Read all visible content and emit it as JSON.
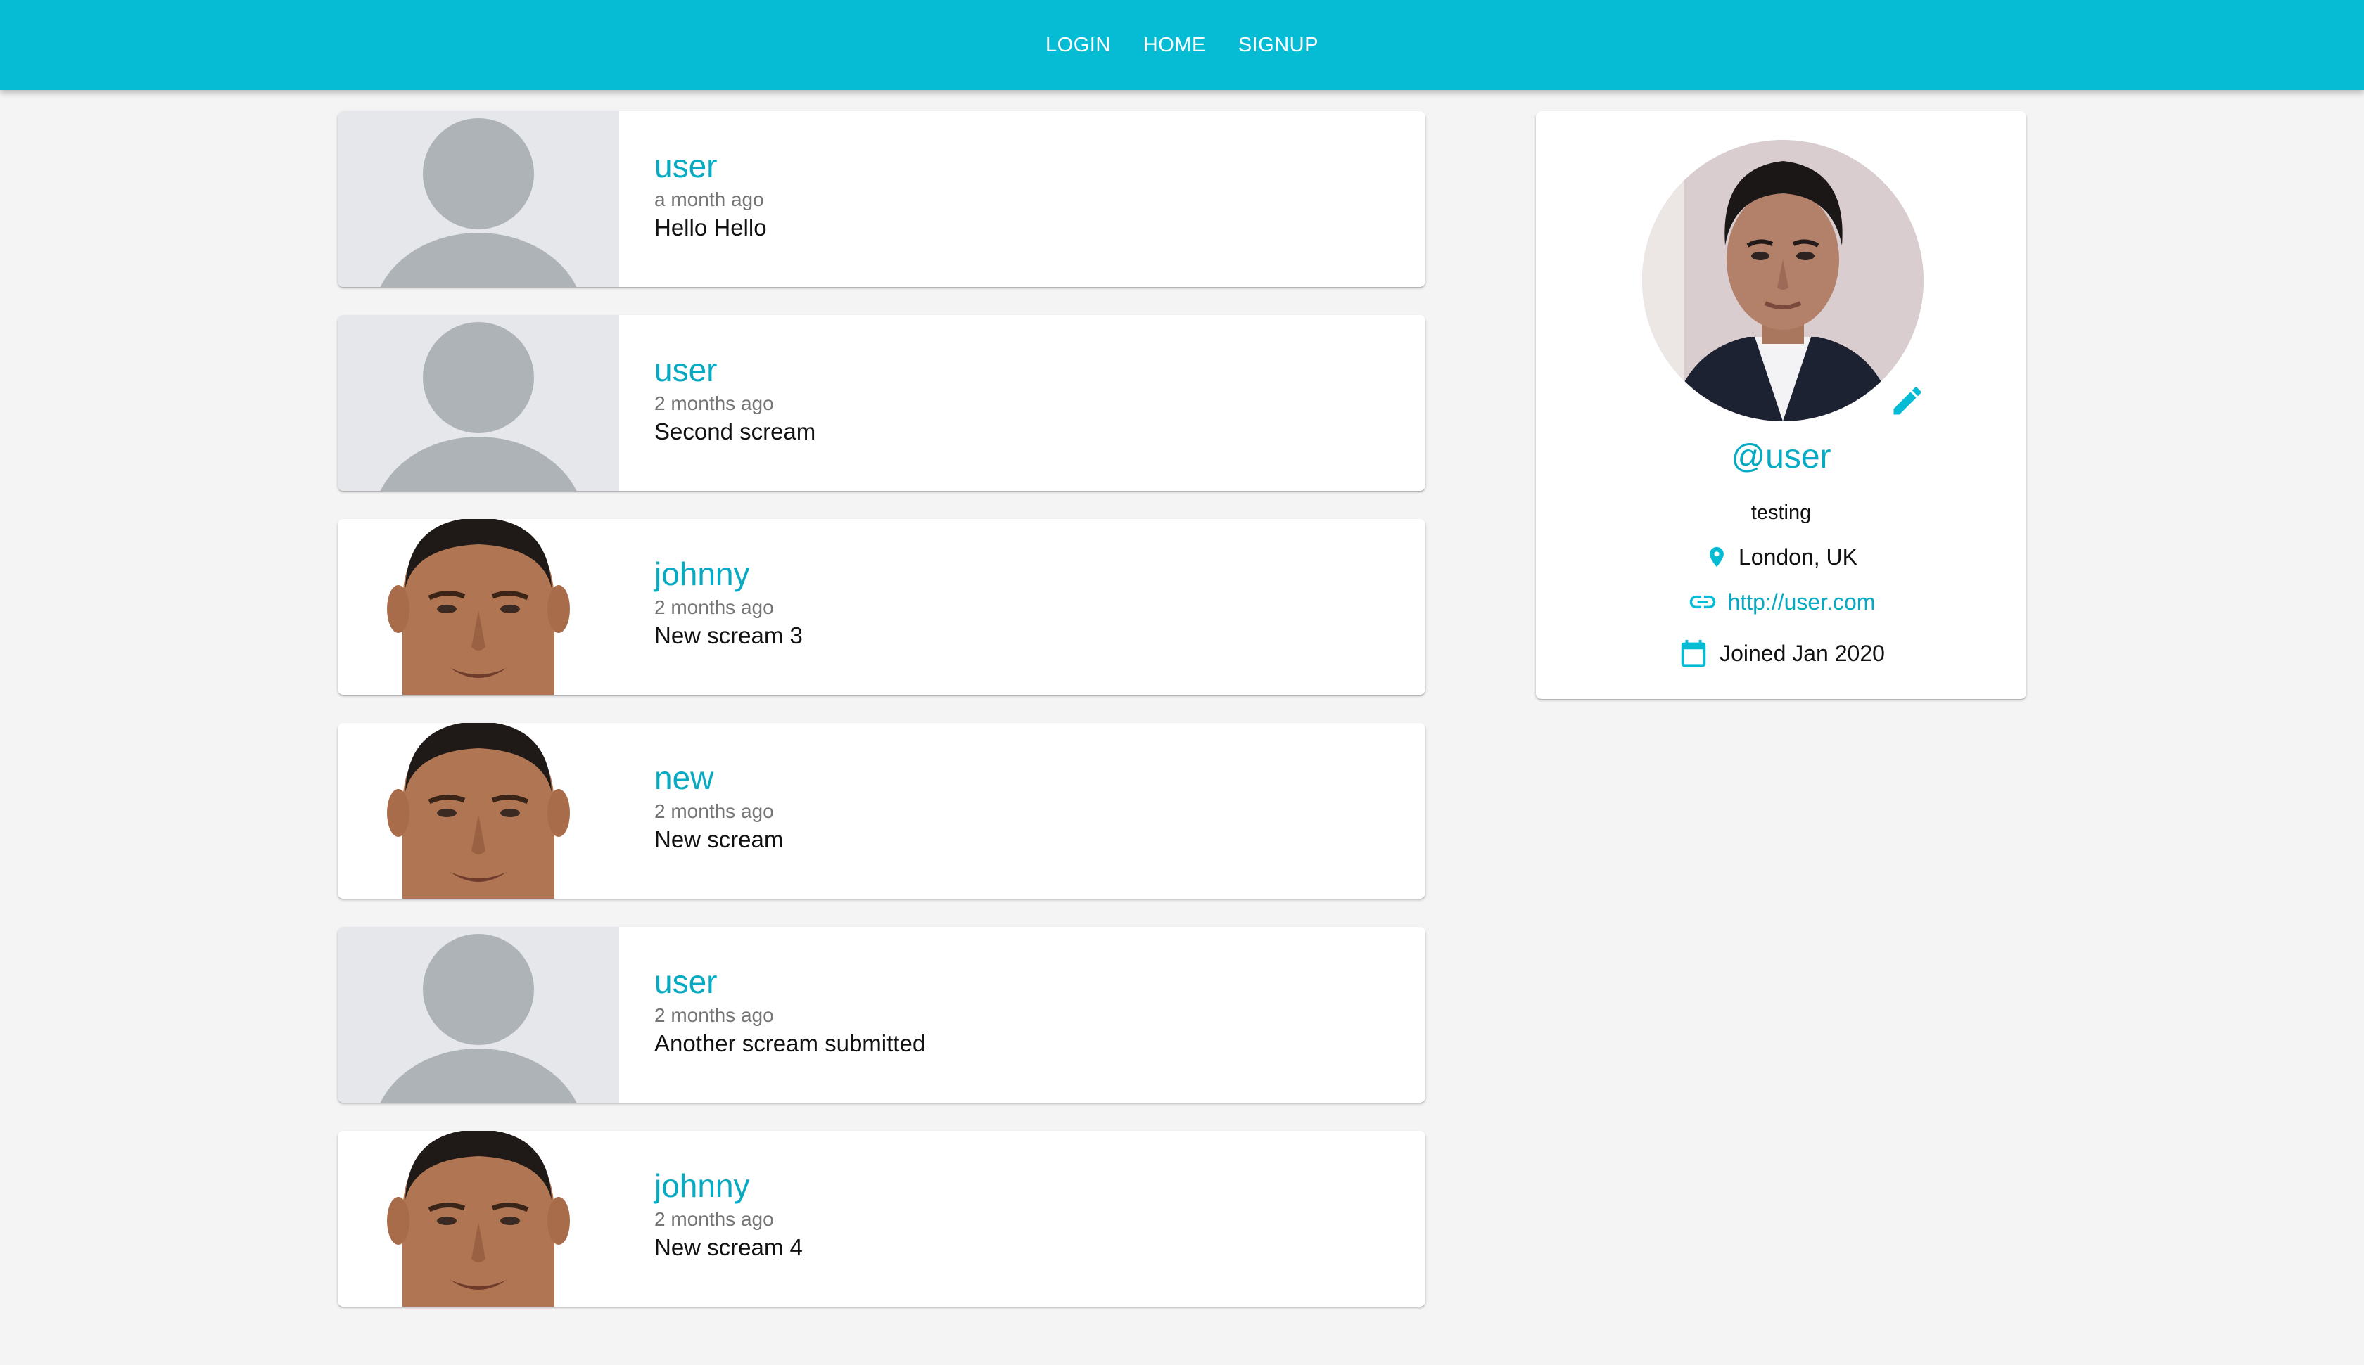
{
  "nav": {
    "login": "LOGIN",
    "home": "HOME",
    "signup": "SIGNUP"
  },
  "colors": {
    "primary": "#06bcd4",
    "accent_text": "#06aac2",
    "page_background": "#f4f4f4"
  },
  "screams": [
    {
      "handle": "user",
      "date": "a month ago",
      "body": "Hello Hello",
      "image": "default-avatar"
    },
    {
      "handle": "user",
      "date": "2 months ago",
      "body": "Second scream",
      "image": "default-avatar"
    },
    {
      "handle": "johnny",
      "date": "2 months ago",
      "body": "New scream 3",
      "image": "portrait-photo"
    },
    {
      "handle": "new",
      "date": "2 months ago",
      "body": "New scream",
      "image": "portrait-photo"
    },
    {
      "handle": "user",
      "date": "2 months ago",
      "body": "Another scream submitted",
      "image": "default-avatar"
    },
    {
      "handle": "johnny",
      "date": "2 months ago",
      "body": "New scream 4",
      "image": "portrait-photo"
    }
  ],
  "profile": {
    "handle": "@user",
    "bio": "testing",
    "location": "London, UK",
    "website": "http://user.com",
    "joined": "Joined Jan 2020",
    "icons": {
      "edit": "pencil-icon",
      "location": "location-pin-icon",
      "website": "link-icon",
      "joined": "calendar-icon"
    }
  }
}
